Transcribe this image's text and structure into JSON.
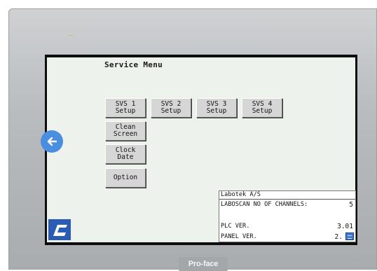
{
  "device": {
    "brand": "Pro-face"
  },
  "screen": {
    "title": "Service Menu",
    "buttons": [
      {
        "label": "SVS 1\nSetup"
      },
      {
        "label": "SVS 2\nSetup"
      },
      {
        "label": "SVS 3\nSetup"
      },
      {
        "label": "SVS 4\nSetup"
      },
      {
        "label": "Clean\nScreen"
      },
      {
        "label": "Clock\nDate"
      },
      {
        "label": "Option"
      }
    ],
    "back_icon": "arrow-left-icon",
    "logo_icon": "labotek-logo-icon",
    "info": {
      "company": "Labotek A/S",
      "channels_label": "LABOSCAN NO OF CHANNELS:",
      "channels_value": "5",
      "plc_label": "PLC VER.",
      "plc_value": "3.01",
      "panel_label": "PANEL VER.",
      "panel_value": "2.",
      "keyboard_icon": "keyboard-icon"
    }
  },
  "colors": {
    "display_bg": "#eef2ec",
    "back_button": "#4a8ee0",
    "logo": "#2a5bb5"
  }
}
